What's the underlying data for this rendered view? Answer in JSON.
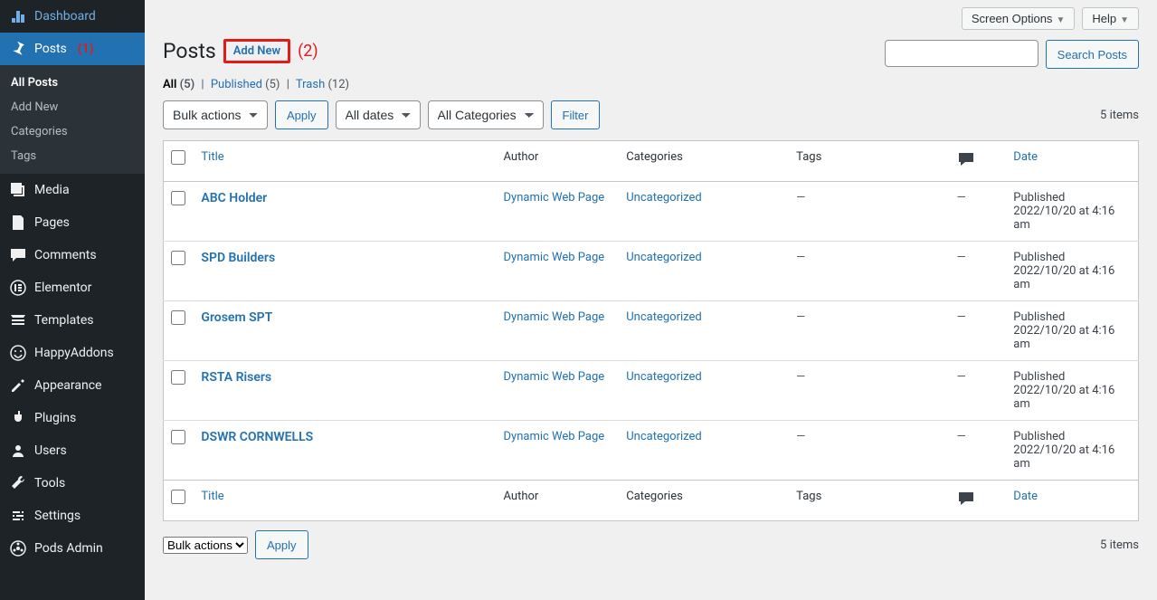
{
  "annotations": {
    "one": "(1)",
    "two": "(2)"
  },
  "sidebar": {
    "items": [
      {
        "label": "Dashboard"
      },
      {
        "label": "Posts"
      },
      {
        "label": "Media"
      },
      {
        "label": "Pages"
      },
      {
        "label": "Comments"
      },
      {
        "label": "Elementor"
      },
      {
        "label": "Templates"
      },
      {
        "label": "HappyAddons"
      },
      {
        "label": "Appearance"
      },
      {
        "label": "Plugins"
      },
      {
        "label": "Users"
      },
      {
        "label": "Tools"
      },
      {
        "label": "Settings"
      },
      {
        "label": "Pods Admin"
      }
    ],
    "submenu": [
      {
        "label": "All Posts"
      },
      {
        "label": "Add New"
      },
      {
        "label": "Categories"
      },
      {
        "label": "Tags"
      }
    ]
  },
  "topbar": {
    "screen_options": "Screen Options",
    "help": "Help"
  },
  "heading": {
    "title": "Posts",
    "add_new": "Add New"
  },
  "subsubsub": {
    "all": "All",
    "all_count": "(5)",
    "published": "Published",
    "published_count": "(5)",
    "trash": "Trash",
    "trash_count": "(12)"
  },
  "filters": {
    "bulk": "Bulk actions",
    "apply": "Apply",
    "dates": "All dates",
    "cats": "All Categories",
    "filter": "Filter",
    "items": "5 items"
  },
  "search": {
    "button": "Search Posts"
  },
  "columns": {
    "title": "Title",
    "author": "Author",
    "categories": "Categories",
    "tags": "Tags",
    "date": "Date"
  },
  "rows": [
    {
      "title": "ABC Holder",
      "author": "Dynamic Web Page",
      "cat": "Uncategorized",
      "tags": "—",
      "comments": "—",
      "status": "Published",
      "date": "2022/10/20 at 4:16 am"
    },
    {
      "title": "SPD Builders",
      "author": "Dynamic Web Page",
      "cat": "Uncategorized",
      "tags": "—",
      "comments": "—",
      "status": "Published",
      "date": "2022/10/20 at 4:16 am"
    },
    {
      "title": "Grosem SPT",
      "author": "Dynamic Web Page",
      "cat": "Uncategorized",
      "tags": "—",
      "comments": "—",
      "status": "Published",
      "date": "2022/10/20 at 4:16 am"
    },
    {
      "title": "RSTA Risers",
      "author": "Dynamic Web Page",
      "cat": "Uncategorized",
      "tags": "—",
      "comments": "—",
      "status": "Published",
      "date": "2022/10/20 at 4:16 am"
    },
    {
      "title": "DSWR CORNWELLS",
      "author": "Dynamic Web Page",
      "cat": "Uncategorized",
      "tags": "—",
      "comments": "—",
      "status": "Published",
      "date": "2022/10/20 at 4:16 am"
    }
  ]
}
